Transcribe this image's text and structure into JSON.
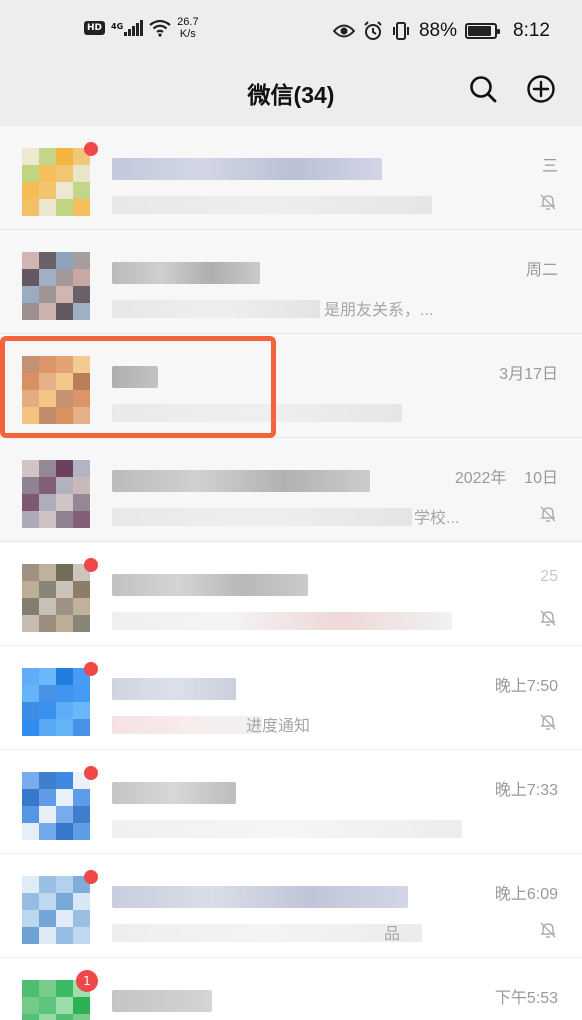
{
  "status_bar": {
    "hd_label": "HD",
    "network": "4G",
    "speed_value": "26.7",
    "speed_unit": "K/s",
    "battery_percent": "88%",
    "battery_level": 0.88,
    "time": "8:12",
    "icons": [
      "eye-icon",
      "alarm-icon",
      "vibrate-icon",
      "battery-icon"
    ]
  },
  "header": {
    "title": "微信(34)",
    "search_icon": "search-icon",
    "add_icon": "plus-circle-icon"
  },
  "chats": [
    {
      "time": "三",
      "message_visible": "",
      "muted": true,
      "unread_dot": true,
      "avatar_colors": [
        "#e9e4c8",
        "#bcd27a",
        "#f4b23c",
        "#f0c064"
      ]
    },
    {
      "time": "周二",
      "message_visible": "是朋友关系，...",
      "muted": false,
      "unread_dot": false,
      "avatar_colors": [
        "#9a8e8e",
        "#c7a6a2",
        "#5a4f58",
        "#8ca0b8"
      ]
    },
    {
      "time": "3月17日",
      "message_visible": "",
      "muted": false,
      "unread_dot": false,
      "avatar_colors": [
        "#e2a070",
        "#f2c27e",
        "#b87a55",
        "#d88a58"
      ]
    },
    {
      "time": "2022年    10日",
      "message_visible": "学校...",
      "muted": true,
      "unread_dot": false,
      "avatar_colors": [
        "#8a7a8a",
        "#6a3c5a",
        "#a8a8b8",
        "#c8b8b8"
      ]
    },
    {
      "time": "25",
      "message_visible": "",
      "muted": true,
      "unread_dot": true,
      "avatar_colors": [
        "#8a7a66",
        "#b8a890",
        "#6e6a58",
        "#c4bcb0"
      ]
    },
    {
      "time": "晚上7:50",
      "message_visible": "进度通知",
      "muted": true,
      "unread_dot": true,
      "avatar_colors": [
        "#2c8af0",
        "#3e9af4",
        "#5ab0f8",
        "#1e7ae0"
      ]
    },
    {
      "time": "晚上7:33",
      "message_visible": "",
      "muted": false,
      "unread_dot": true,
      "avatar_colors": [
        "#3a86e0",
        "#e8eef8",
        "#5a9ae8",
        "#2a70c8"
      ]
    },
    {
      "time": "晚上6:09",
      "message_visible": "品",
      "muted": true,
      "unread_dot": true,
      "avatar_colors": [
        "#8eb8e0",
        "#b0d0ee",
        "#6a9ed2",
        "#d8e6f4"
      ]
    },
    {
      "time": "下午5:53",
      "message_visible": "",
      "muted": false,
      "unread_dot": true,
      "unread_count": "1",
      "avatar_colors": [
        "#28b050",
        "#6ac880",
        "#38b860",
        "#90d8a0"
      ]
    }
  ],
  "accent_colors": {
    "unread": "#f04848",
    "highlight": "#f4633a"
  }
}
